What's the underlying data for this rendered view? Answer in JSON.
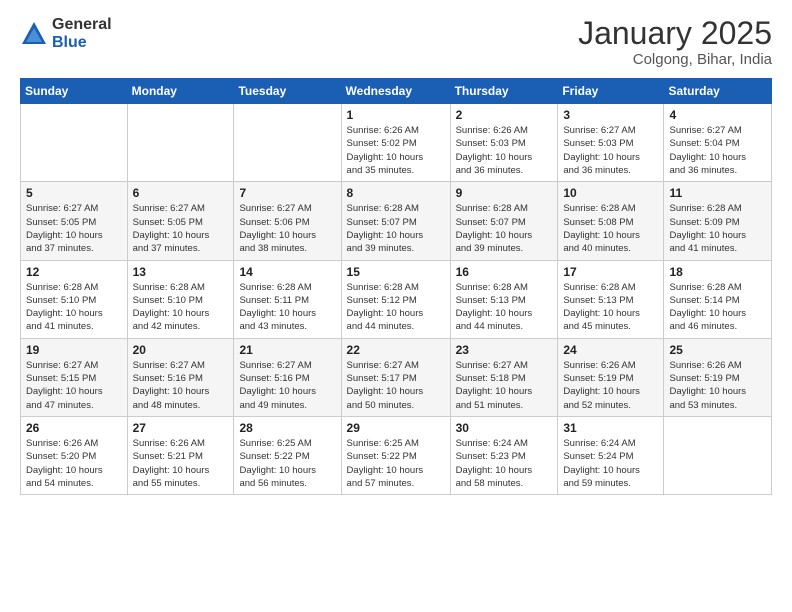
{
  "logo": {
    "general": "General",
    "blue": "Blue"
  },
  "title": {
    "month_year": "January 2025",
    "location": "Colgong, Bihar, India"
  },
  "weekdays": [
    "Sunday",
    "Monday",
    "Tuesday",
    "Wednesday",
    "Thursday",
    "Friday",
    "Saturday"
  ],
  "weeks": [
    [
      {
        "day": "",
        "info": ""
      },
      {
        "day": "",
        "info": ""
      },
      {
        "day": "",
        "info": ""
      },
      {
        "day": "1",
        "info": "Sunrise: 6:26 AM\nSunset: 5:02 PM\nDaylight: 10 hours\nand 35 minutes."
      },
      {
        "day": "2",
        "info": "Sunrise: 6:26 AM\nSunset: 5:03 PM\nDaylight: 10 hours\nand 36 minutes."
      },
      {
        "day": "3",
        "info": "Sunrise: 6:27 AM\nSunset: 5:03 PM\nDaylight: 10 hours\nand 36 minutes."
      },
      {
        "day": "4",
        "info": "Sunrise: 6:27 AM\nSunset: 5:04 PM\nDaylight: 10 hours\nand 36 minutes."
      }
    ],
    [
      {
        "day": "5",
        "info": "Sunrise: 6:27 AM\nSunset: 5:05 PM\nDaylight: 10 hours\nand 37 minutes."
      },
      {
        "day": "6",
        "info": "Sunrise: 6:27 AM\nSunset: 5:05 PM\nDaylight: 10 hours\nand 37 minutes."
      },
      {
        "day": "7",
        "info": "Sunrise: 6:27 AM\nSunset: 5:06 PM\nDaylight: 10 hours\nand 38 minutes."
      },
      {
        "day": "8",
        "info": "Sunrise: 6:28 AM\nSunset: 5:07 PM\nDaylight: 10 hours\nand 39 minutes."
      },
      {
        "day": "9",
        "info": "Sunrise: 6:28 AM\nSunset: 5:07 PM\nDaylight: 10 hours\nand 39 minutes."
      },
      {
        "day": "10",
        "info": "Sunrise: 6:28 AM\nSunset: 5:08 PM\nDaylight: 10 hours\nand 40 minutes."
      },
      {
        "day": "11",
        "info": "Sunrise: 6:28 AM\nSunset: 5:09 PM\nDaylight: 10 hours\nand 41 minutes."
      }
    ],
    [
      {
        "day": "12",
        "info": "Sunrise: 6:28 AM\nSunset: 5:10 PM\nDaylight: 10 hours\nand 41 minutes."
      },
      {
        "day": "13",
        "info": "Sunrise: 6:28 AM\nSunset: 5:10 PM\nDaylight: 10 hours\nand 42 minutes."
      },
      {
        "day": "14",
        "info": "Sunrise: 6:28 AM\nSunset: 5:11 PM\nDaylight: 10 hours\nand 43 minutes."
      },
      {
        "day": "15",
        "info": "Sunrise: 6:28 AM\nSunset: 5:12 PM\nDaylight: 10 hours\nand 44 minutes."
      },
      {
        "day": "16",
        "info": "Sunrise: 6:28 AM\nSunset: 5:13 PM\nDaylight: 10 hours\nand 44 minutes."
      },
      {
        "day": "17",
        "info": "Sunrise: 6:28 AM\nSunset: 5:13 PM\nDaylight: 10 hours\nand 45 minutes."
      },
      {
        "day": "18",
        "info": "Sunrise: 6:28 AM\nSunset: 5:14 PM\nDaylight: 10 hours\nand 46 minutes."
      }
    ],
    [
      {
        "day": "19",
        "info": "Sunrise: 6:27 AM\nSunset: 5:15 PM\nDaylight: 10 hours\nand 47 minutes."
      },
      {
        "day": "20",
        "info": "Sunrise: 6:27 AM\nSunset: 5:16 PM\nDaylight: 10 hours\nand 48 minutes."
      },
      {
        "day": "21",
        "info": "Sunrise: 6:27 AM\nSunset: 5:16 PM\nDaylight: 10 hours\nand 49 minutes."
      },
      {
        "day": "22",
        "info": "Sunrise: 6:27 AM\nSunset: 5:17 PM\nDaylight: 10 hours\nand 50 minutes."
      },
      {
        "day": "23",
        "info": "Sunrise: 6:27 AM\nSunset: 5:18 PM\nDaylight: 10 hours\nand 51 minutes."
      },
      {
        "day": "24",
        "info": "Sunrise: 6:26 AM\nSunset: 5:19 PM\nDaylight: 10 hours\nand 52 minutes."
      },
      {
        "day": "25",
        "info": "Sunrise: 6:26 AM\nSunset: 5:19 PM\nDaylight: 10 hours\nand 53 minutes."
      }
    ],
    [
      {
        "day": "26",
        "info": "Sunrise: 6:26 AM\nSunset: 5:20 PM\nDaylight: 10 hours\nand 54 minutes."
      },
      {
        "day": "27",
        "info": "Sunrise: 6:26 AM\nSunset: 5:21 PM\nDaylight: 10 hours\nand 55 minutes."
      },
      {
        "day": "28",
        "info": "Sunrise: 6:25 AM\nSunset: 5:22 PM\nDaylight: 10 hours\nand 56 minutes."
      },
      {
        "day": "29",
        "info": "Sunrise: 6:25 AM\nSunset: 5:22 PM\nDaylight: 10 hours\nand 57 minutes."
      },
      {
        "day": "30",
        "info": "Sunrise: 6:24 AM\nSunset: 5:23 PM\nDaylight: 10 hours\nand 58 minutes."
      },
      {
        "day": "31",
        "info": "Sunrise: 6:24 AM\nSunset: 5:24 PM\nDaylight: 10 hours\nand 59 minutes."
      },
      {
        "day": "",
        "info": ""
      }
    ]
  ]
}
